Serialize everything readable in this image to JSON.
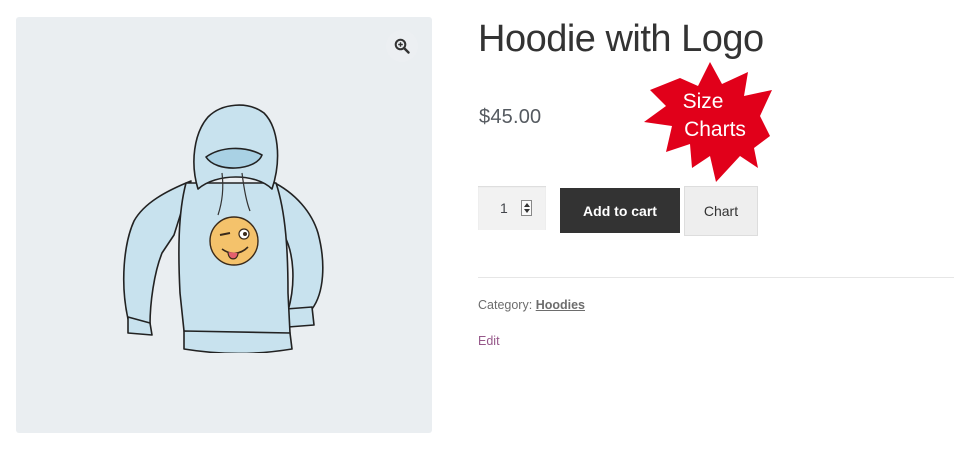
{
  "gallery": {
    "image_alt": "Hoodie with Logo",
    "zoom_icon": "magnifier-zoom-icon"
  },
  "product": {
    "title": "Hoodie with Logo",
    "price": "$45.00",
    "category_label": "Category:",
    "category_link": "Hoodies",
    "edit_label": "Edit"
  },
  "badge": {
    "line1": "Size",
    "line2": "Charts",
    "color": "#e1001a"
  },
  "cart": {
    "quantity": "1",
    "add_to_cart_label": "Add to cart",
    "chart_label": "Chart"
  },
  "colors": {
    "button_dark": "#333333",
    "link_purple": "#96588a",
    "gallery_bg": "#eaeef1"
  }
}
